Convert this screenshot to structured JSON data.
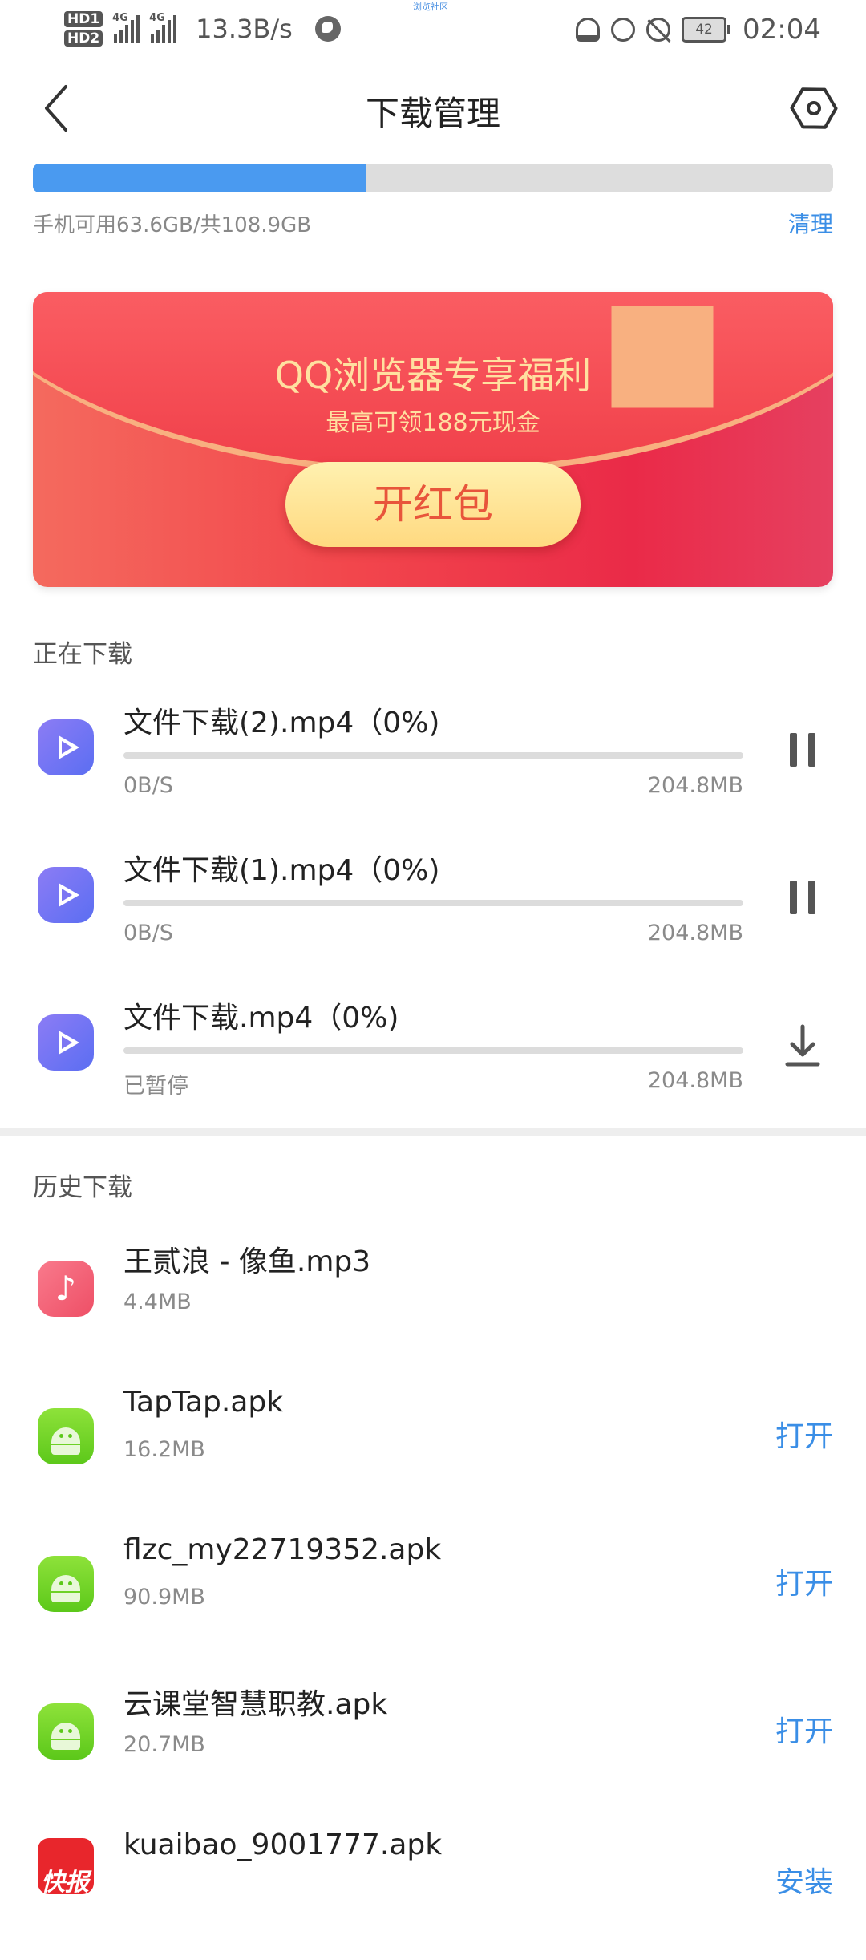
{
  "status_bar": {
    "hd1": "HD1",
    "hd2": "HD2",
    "network1": "4G",
    "network2": "4G",
    "net_speed": "13.3B/s",
    "top_label": "浏览社区",
    "battery": "42",
    "time": "02:04"
  },
  "header": {
    "title": "下载管理"
  },
  "storage": {
    "used_fraction": 0.416,
    "text": "手机可用63.6GB/共108.9GB",
    "clean_label": "清理"
  },
  "banner": {
    "title": "QQ浏览器专享福利",
    "subtitle": "最高可领188元现金",
    "button": "开红包"
  },
  "downloading": {
    "section_title": "正在下载",
    "items": [
      {
        "name": "文件下载(2).mp4（0%)",
        "status": "0B/S",
        "size": "204.8MB",
        "progress": 0,
        "action": "pause"
      },
      {
        "name": "文件下载(1).mp4（0%)",
        "status": "0B/S",
        "size": "204.8MB",
        "progress": 0,
        "action": "pause"
      },
      {
        "name": "文件下载.mp4（0%)",
        "status": "已暂停",
        "size": "204.8MB",
        "progress": 0,
        "action": "download"
      }
    ]
  },
  "history": {
    "section_title": "历史下载",
    "items": [
      {
        "name": "王贰浪 - 像鱼.mp3",
        "size": "4.4MB",
        "icon": "music-icon",
        "action": ""
      },
      {
        "name": "TapTap.apk",
        "size": "16.2MB",
        "icon": "android-apk-icon",
        "action": "打开"
      },
      {
        "name": "flzc_my22719352.apk",
        "size": "90.9MB",
        "icon": "android-apk-icon",
        "action": "打开"
      },
      {
        "name": "云课堂智慧职教.apk",
        "size": "20.7MB",
        "icon": "android-apk-icon",
        "action": "打开"
      },
      {
        "name": "kuaibao_9001777.apk",
        "size": "",
        "icon": "kuaibao-app-icon",
        "icon_text": "快报",
        "action": "安装"
      }
    ]
  },
  "colors": {
    "accent_blue": "#3a8ee6",
    "storage_fill": "#4a9af0",
    "banner_red": "#f2464c",
    "banner_gold": "#ffe0a0"
  }
}
